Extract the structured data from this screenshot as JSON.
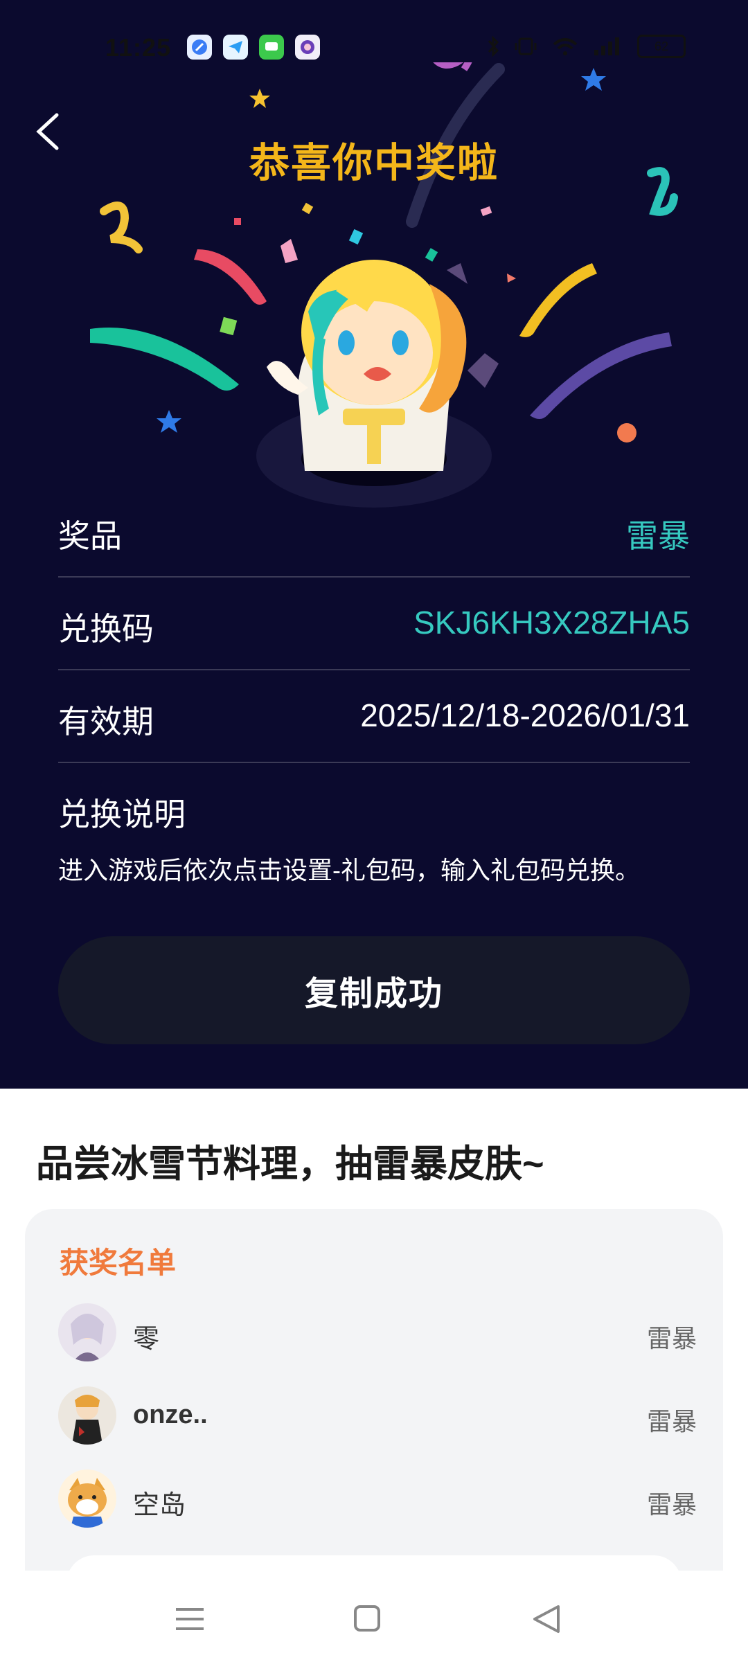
{
  "status_bar": {
    "time": "11:25",
    "battery": "62",
    "icons": [
      "bluetooth-icon",
      "vibrate-icon",
      "wifi-icon",
      "signal-icon",
      "battery-icon"
    ]
  },
  "header": {
    "back_icon": "chevron-left-icon",
    "title": "恭喜你中奖啦"
  },
  "prize_info": {
    "prize_label": "奖品",
    "prize_value": "雷暴",
    "code_label": "兑换码",
    "code_value": "SKJ6KH3X28ZHA5",
    "validity_label": "有效期",
    "validity_value": "2025/12/18-2026/01/31",
    "note_title": "兑换说明",
    "note_text": "进入游戏后依次点击设置-礼包码，输入礼包码兑换。"
  },
  "copy_button_label": "复制成功",
  "event": {
    "title": "品尝冰雪节料理，抽雷暴皮肤~",
    "winners_title": "获奖名单",
    "winners": [
      {
        "name": "零",
        "prize": "雷暴"
      },
      {
        "name": "onze..",
        "prize": "雷暴"
      },
      {
        "name": "空岛",
        "prize": "雷暴"
      }
    ]
  },
  "colors": {
    "background_dark": "#0b0a2e",
    "title_yellow": "#f4b61a",
    "teal": "#36c9c0",
    "button_dark": "#151829",
    "winners_orange": "#f07a3c"
  },
  "nav_bar": [
    "menu-icon",
    "home-icon",
    "back-triangle-icon"
  ]
}
